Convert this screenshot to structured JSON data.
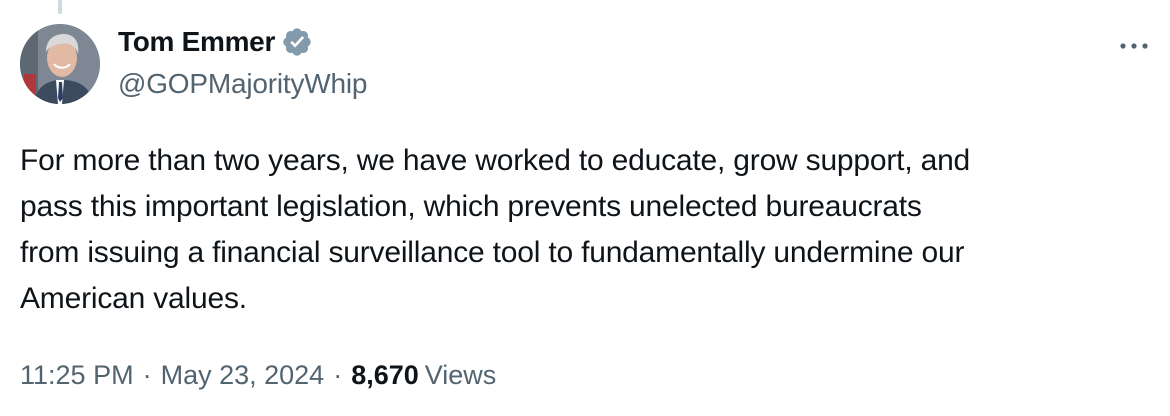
{
  "author": {
    "display_name": "Tom Emmer",
    "handle": "@GOPMajorityWhip",
    "verified": true,
    "avatar_icon": "profile-photo"
  },
  "tweet": {
    "text": "For more than two years, we have worked to educate, grow support, and\npass this important legislation, which prevents unelected bureaucrats\nfrom issuing a financial surveillance tool to fundamentally undermine our\nAmerican values."
  },
  "meta": {
    "time": "11:25 PM",
    "separator": "·",
    "date": "May 23, 2024",
    "views_count": "8,670",
    "views_label": "Views"
  },
  "icons": {
    "more": "more-horizontal-icon",
    "verified": "verified-badge-icon"
  },
  "colors": {
    "text_primary": "#0f1419",
    "text_secondary": "#536471",
    "verified_badge": "#829aab"
  }
}
